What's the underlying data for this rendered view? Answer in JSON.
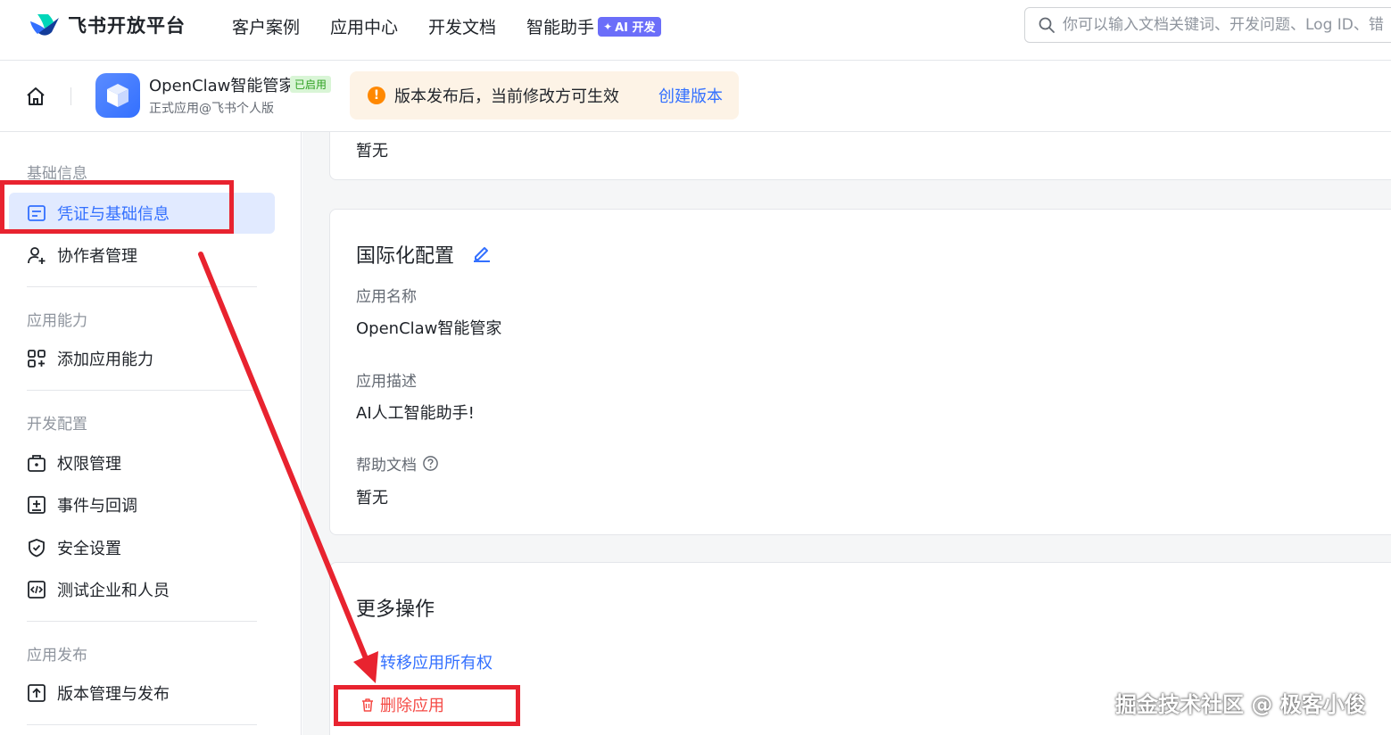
{
  "header": {
    "brand": "飞书开放平台",
    "nav": [
      "客户案例",
      "应用中心",
      "开发文档",
      "智能助手"
    ],
    "ai_badge": "AI 开发",
    "search_placeholder": "你可以输入文档关键词、开发问题、Log ID、错"
  },
  "appbar": {
    "app_name": "OpenClaw智能管家",
    "status": "已启用",
    "subtitle": "正式应用@飞书个人版",
    "notice_text": "版本发布后，当前修改方可生效",
    "notice_link": "创建版本",
    "notice_icon": "!"
  },
  "sidebar": {
    "sections": [
      {
        "title": "基础信息",
        "items": [
          "凭证与基础信息",
          "协作者管理"
        ]
      },
      {
        "title": "应用能力",
        "items": [
          "添加应用能力"
        ]
      },
      {
        "title": "开发配置",
        "items": [
          "权限管理",
          "事件与回调",
          "安全设置",
          "测试企业和人员"
        ]
      },
      {
        "title": "应用发布",
        "items": [
          "版本管理与发布"
        ]
      }
    ],
    "active_item": "凭证与基础信息"
  },
  "main": {
    "top_card_value": "暂无",
    "i18n": {
      "title": "国际化配置",
      "fields": [
        {
          "label": "应用名称",
          "value": "OpenClaw智能管家"
        },
        {
          "label": "应用描述",
          "value": "AI人工智能助手!"
        },
        {
          "label": "帮助文档",
          "value": "暂无"
        }
      ]
    },
    "more": {
      "title": "更多操作",
      "transfer": "转移应用所有权",
      "delete": "删除应用"
    }
  },
  "watermark": "掘金技术社区 @ 极客小俊",
  "colors": {
    "primary": "#3370ff",
    "danger": "#f54a45",
    "annotation": "#e8232f",
    "notice_bg": "#fdf3e6",
    "active_bg": "#e1eaff"
  }
}
